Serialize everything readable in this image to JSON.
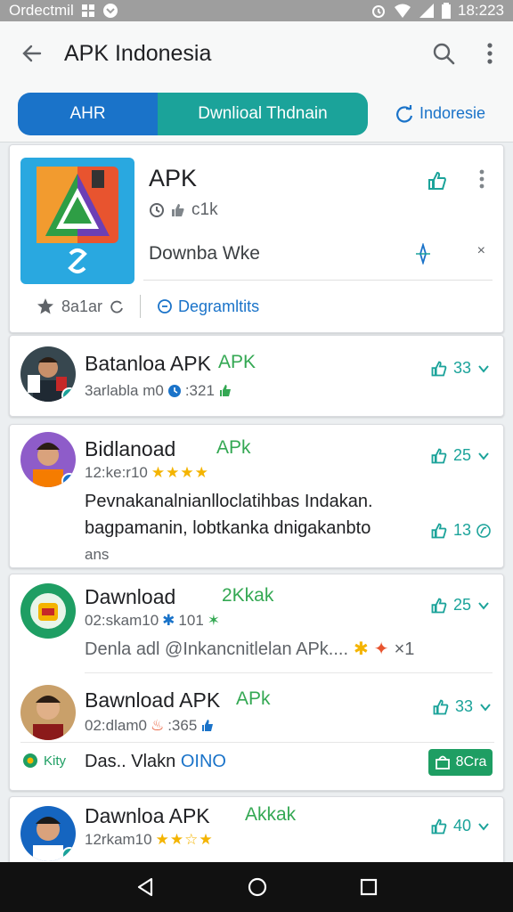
{
  "status_bar": {
    "left_text": "Ordectmil",
    "time": "18:223",
    "icons": [
      "grid-icon",
      "chevron-icon",
      "alarm-icon",
      "wifi-icon",
      "signal-icon",
      "battery-icon"
    ]
  },
  "app_bar": {
    "title": "APK Indonesia",
    "icons": [
      "back-arrow-icon",
      "search-icon",
      "more-vert-icon"
    ]
  },
  "tabs": {
    "tab1": "AHR",
    "tab2": "Dwnlioal Thdnain",
    "language": "Indoresie"
  },
  "hero": {
    "title": "APK",
    "meta": "c1k",
    "download_label": "Downba Wke",
    "close_glyph": "×",
    "rating_label": "8a1ar",
    "program_link": "Degramltits"
  },
  "items": [
    {
      "name": "Batanloa APK",
      "tag": "APK",
      "sub": "3arlabla m0",
      "sub_extra": ":321",
      "likes": "33"
    },
    {
      "name": "Bidlanoad",
      "tag": "APk",
      "sub": "12:ke:r10",
      "stars": "★★★★",
      "likes": "25",
      "desc_line1": "Pevnakanalnianlloclatihbas Indakan.",
      "desc_line2": "bagpamanin, lobtkanka dnigakanbto",
      "desc_line3": "ans",
      "likes2": "13"
    },
    {
      "name": "Dawnload",
      "tag": "2Kkak",
      "sub": "02:skam10",
      "sub_extra": "101",
      "likes": "25",
      "desc": "Denla adl @Inkancnitlelan APk....",
      "desc_tail": "×1"
    },
    {
      "name": "Bawnload APK",
      "tag": "APk",
      "sub": "02:dlam0",
      "sub_extra": ":365",
      "likes": "33",
      "chip": "Kity",
      "desc": "Das.. Vlakn",
      "desc_bold": "OINO",
      "button": "8Cra"
    },
    {
      "name": "Dawnloa APK",
      "tag": "Akkak",
      "sub": "12rkam10",
      "stars": "★★☆★",
      "likes": "40"
    }
  ],
  "colors": {
    "blue": "#1a73c9",
    "teal": "#1ba39a",
    "green": "#34a853",
    "star": "#f4b400"
  }
}
